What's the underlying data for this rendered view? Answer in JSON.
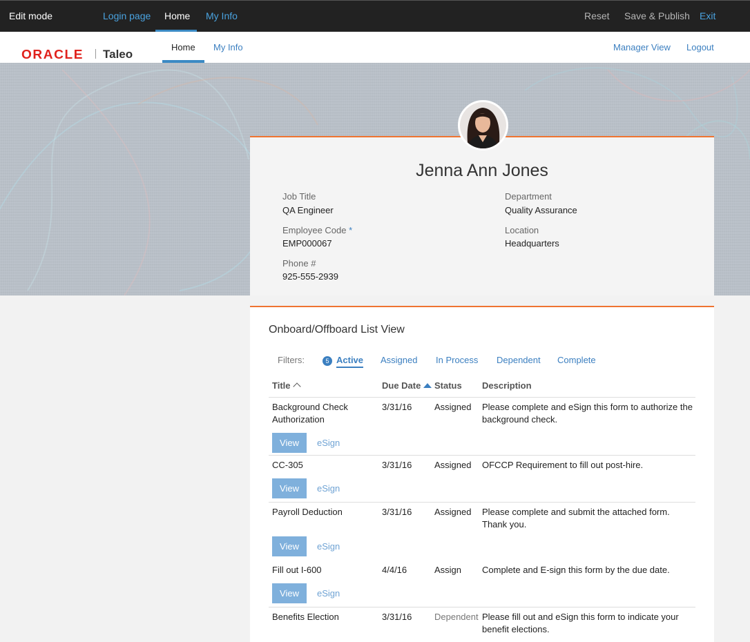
{
  "editbar": {
    "mode_label": "Edit mode",
    "nav": [
      "Login page",
      "Home",
      "My Info"
    ],
    "reset": "Reset",
    "save_publish": "Save & Publish",
    "exit": "Exit"
  },
  "header": {
    "logo_oracle": "ORACLE",
    "logo_taleo": "Taleo",
    "tabs": [
      "Home",
      "My Info"
    ],
    "manager_view": "Manager View",
    "logout": "Logout"
  },
  "profile": {
    "name": "Jenna Ann Jones",
    "job_title_label": "Job Title",
    "job_title": "QA Engineer",
    "employee_code_label": "Employee Code",
    "required_mark": "*",
    "employee_code": "EMP000067",
    "phone_label": "Phone #",
    "phone": "925-555-2939",
    "department_label": "Department",
    "department": "Quality Assurance",
    "location_label": "Location",
    "location": "Headquarters"
  },
  "list": {
    "title": "Onboard/Offboard List View",
    "filters_label": "Filters:",
    "active_count": "5",
    "filters": [
      "Active",
      "Assigned",
      "In Process",
      "Dependent",
      "Complete"
    ],
    "columns": [
      "Title",
      "Due Date",
      "Status",
      "Description"
    ],
    "view_label": "View",
    "esign_label": "eSign",
    "rows": [
      {
        "title": "Background Check Authorization",
        "due": "3/31/16",
        "status": "Assigned",
        "desc": "Please complete and eSign this form to authorize the background check."
      },
      {
        "title": "CC-305",
        "due": "3/31/16",
        "status": "Assigned",
        "desc": "OFCCP Requirement to fill out post-hire."
      },
      {
        "title": "Payroll Deduction",
        "due": "3/31/16",
        "status": "Assigned",
        "desc": "Please complete and submit the attached form. Thank you."
      },
      {
        "title": "Fill out I-600",
        "due": "4/4/16",
        "status": "Assign",
        "desc": "Complete and E-sign this form by the due date."
      },
      {
        "title": "Benefits Election",
        "due": "3/31/16",
        "status": "Dependent",
        "desc": "Please fill out and eSign this form to indicate your benefit elections."
      }
    ]
  },
  "colors": {
    "accent": "#ef7330",
    "link": "#3b7fc0",
    "button": "#7fb0dc"
  }
}
